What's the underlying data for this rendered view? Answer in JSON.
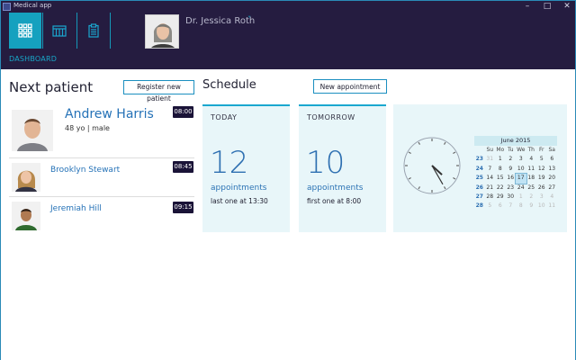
{
  "window": {
    "title": "Medical app",
    "minimize": "–",
    "maximize": "□",
    "close": "✕"
  },
  "nav": {
    "dashboard_label": "DASHBOARD"
  },
  "doctor": {
    "name": "Dr. Jessica Roth",
    "menu_chevron": "˅"
  },
  "next_patient": {
    "heading": "Next patient",
    "register_button": "Register new patient",
    "patients": [
      {
        "name": "Andrew Harris",
        "details": "48 yo | male",
        "time": "08:00"
      },
      {
        "name": "Brooklyn Stewart",
        "time": "08:45"
      },
      {
        "name": "Jeremiah Hill",
        "time": "09:15"
      }
    ]
  },
  "schedule": {
    "heading": "Schedule",
    "new_appointment_button": "New appointment",
    "today": {
      "label": "TODAY",
      "count": "12",
      "unit": "appointments",
      "last": "last one at 13:30"
    },
    "tomorrow": {
      "label": "TOMORROW",
      "count": "10",
      "unit": "appointments",
      "last": "first one at 8:00"
    }
  },
  "calendar": {
    "month_title": "June 2015",
    "weekday_headers": [
      "",
      "Su",
      "Mo",
      "Tu",
      "We",
      "Th",
      "Fr",
      "Sa"
    ],
    "selected_day": "17",
    "weeks": [
      {
        "week": "23",
        "days": [
          "31",
          "1",
          "2",
          "3",
          "4",
          "5",
          "6"
        ],
        "dim": [
          true,
          false,
          false,
          false,
          false,
          false,
          false
        ]
      },
      {
        "week": "24",
        "days": [
          "7",
          "8",
          "9",
          "10",
          "11",
          "12",
          "13"
        ],
        "dim": [
          false,
          false,
          false,
          false,
          false,
          false,
          false
        ]
      },
      {
        "week": "25",
        "days": [
          "14",
          "15",
          "16",
          "17",
          "18",
          "19",
          "20"
        ],
        "dim": [
          false,
          false,
          false,
          false,
          false,
          false,
          false
        ]
      },
      {
        "week": "26",
        "days": [
          "21",
          "22",
          "23",
          "24",
          "25",
          "26",
          "27"
        ],
        "dim": [
          false,
          false,
          false,
          false,
          false,
          false,
          false
        ]
      },
      {
        "week": "27",
        "days": [
          "28",
          "29",
          "30",
          "1",
          "2",
          "3",
          "4"
        ],
        "dim": [
          false,
          false,
          false,
          true,
          true,
          true,
          true
        ]
      },
      {
        "week": "28",
        "days": [
          "5",
          "6",
          "7",
          "8",
          "9",
          "10",
          "11"
        ],
        "dim": [
          true,
          true,
          true,
          true,
          true,
          true,
          true
        ]
      }
    ]
  },
  "clock": {
    "hour": 4,
    "minute": 25
  },
  "colors": {
    "accent": "#15a1bf",
    "header_bg": "#251c40",
    "tile_bg": "#e8f6f9",
    "badge_bg": "#1a1337",
    "link_blue": "#2572b7"
  }
}
